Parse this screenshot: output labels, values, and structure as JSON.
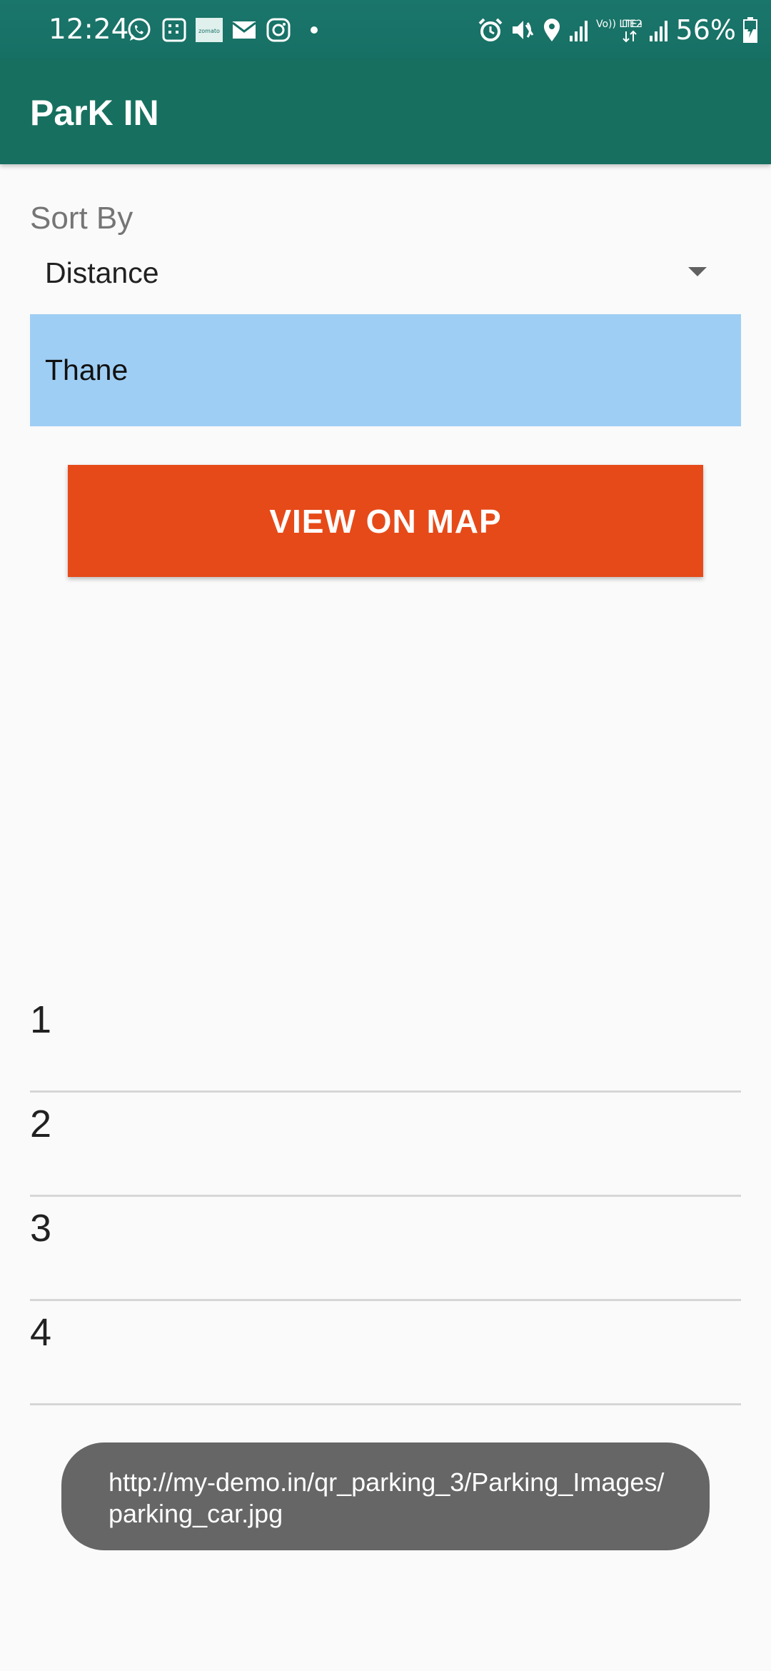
{
  "status_bar": {
    "time": "12:24",
    "battery_percent": "56%",
    "left_icons": [
      "whatsapp-icon",
      "calculator-icon",
      "zomato-icon",
      "mail-icon",
      "instagram-icon",
      "dot-icon"
    ],
    "right_icons": [
      "alarm-icon",
      "mute-icon",
      "location-icon",
      "signal-icon",
      "volte-lte-icon",
      "signal-icon",
      "battery-charging-icon"
    ],
    "zomato_text": "zomato",
    "volte_text": "Vo)) LTE2",
    "lte_text": "LTE+"
  },
  "app_bar": {
    "title": "ParK IN"
  },
  "sort": {
    "label": "Sort By",
    "selected": "Distance"
  },
  "location": {
    "value": "Thane"
  },
  "map_button": {
    "label": "VIEW ON MAP"
  },
  "list": {
    "items": [
      {
        "label": "1"
      },
      {
        "label": "2"
      },
      {
        "label": "3"
      },
      {
        "label": "4"
      }
    ]
  },
  "toast": {
    "text": "http://my-demo.in/qr_parking_3/Parking_Images/parking_car.jpg"
  },
  "colors": {
    "status_bar": "#1a756b",
    "app_bar": "#17705f",
    "location_box": "#9fcef4",
    "button": "#e64a19",
    "toast": "#666666",
    "background": "#fafafa"
  }
}
